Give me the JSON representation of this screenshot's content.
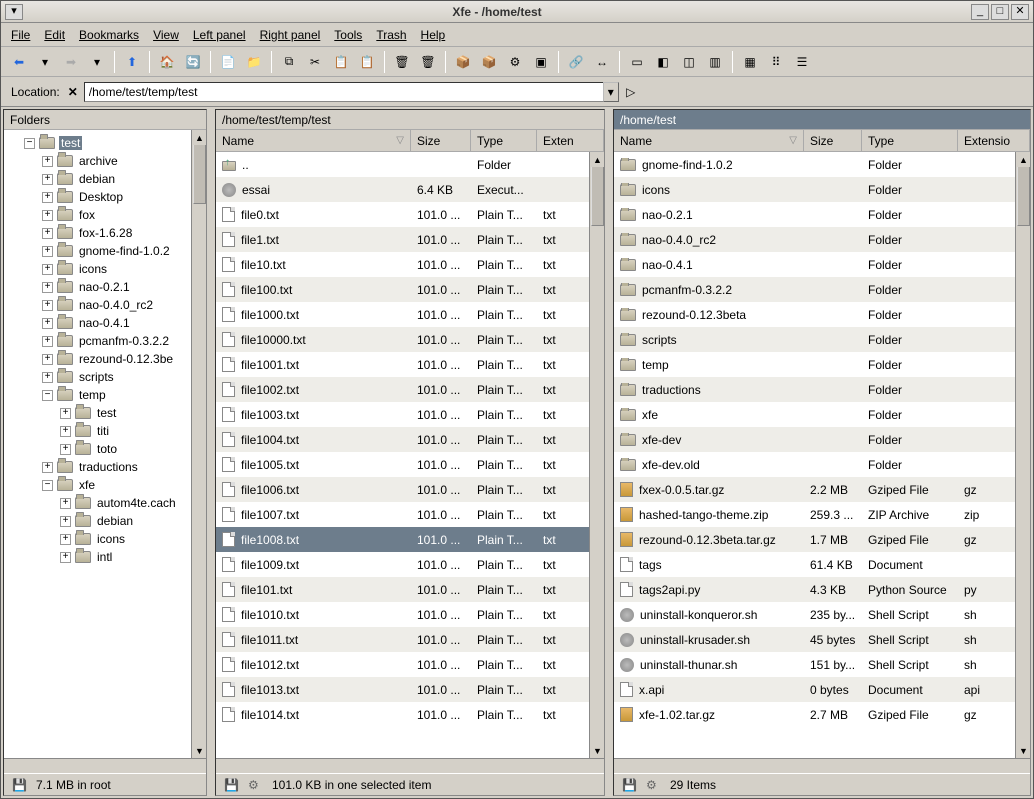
{
  "title": "Xfe - /home/test",
  "menus": [
    "File",
    "Edit",
    "Bookmarks",
    "View",
    "Left panel",
    "Right panel",
    "Tools",
    "Trash",
    "Help"
  ],
  "location": {
    "label": "Location:",
    "value": "/home/test/temp/test"
  },
  "tree": {
    "header": "Folders",
    "root": {
      "label": "test",
      "sel": true
    },
    "items": [
      {
        "label": "archive",
        "d": 1,
        "exp": "+"
      },
      {
        "label": "debian",
        "d": 1,
        "exp": "+"
      },
      {
        "label": "Desktop",
        "d": 1,
        "exp": "+"
      },
      {
        "label": "fox",
        "d": 1,
        "exp": "+"
      },
      {
        "label": "fox-1.6.28",
        "d": 1,
        "exp": "+"
      },
      {
        "label": "gnome-find-1.0.2",
        "d": 1,
        "exp": "+"
      },
      {
        "label": "icons",
        "d": 1,
        "exp": "+"
      },
      {
        "label": "nao-0.2.1",
        "d": 1,
        "exp": "+"
      },
      {
        "label": "nao-0.4.0_rc2",
        "d": 1,
        "exp": "+"
      },
      {
        "label": "nao-0.4.1",
        "d": 1,
        "exp": "+"
      },
      {
        "label": "pcmanfm-0.3.2.2",
        "d": 1,
        "exp": "+"
      },
      {
        "label": "rezound-0.12.3be",
        "d": 1,
        "exp": "+"
      },
      {
        "label": "scripts",
        "d": 1,
        "exp": "+"
      },
      {
        "label": "temp",
        "d": 1,
        "exp": "-"
      },
      {
        "label": "test",
        "d": 2,
        "exp": "+"
      },
      {
        "label": "titi",
        "d": 2,
        "exp": "+"
      },
      {
        "label": "toto",
        "d": 2,
        "exp": "+"
      },
      {
        "label": "traductions",
        "d": 1,
        "exp": "+"
      },
      {
        "label": "xfe",
        "d": 1,
        "exp": "-"
      },
      {
        "label": "autom4te.cach",
        "d": 2,
        "exp": "+"
      },
      {
        "label": "debian",
        "d": 2,
        "exp": "+"
      },
      {
        "label": "icons",
        "d": 2,
        "exp": "+"
      },
      {
        "label": "intl",
        "d": 2,
        "exp": "+"
      }
    ],
    "status": "7.1 MB in root"
  },
  "mid": {
    "path": "/home/test/temp/test",
    "cols": {
      "name": "Name",
      "size": "Size",
      "type": "Type",
      "ext": "Exten"
    },
    "rows": [
      {
        "icon": "up",
        "name": "..",
        "size": "",
        "type": "Folder",
        "ext": ""
      },
      {
        "icon": "gear",
        "name": "essai",
        "size": "6.4 KB",
        "type": "Execut...",
        "ext": ""
      },
      {
        "icon": "doc",
        "name": "file0.txt",
        "size": "101.0 ...",
        "type": "Plain T...",
        "ext": "txt"
      },
      {
        "icon": "doc",
        "name": "file1.txt",
        "size": "101.0 ...",
        "type": "Plain T...",
        "ext": "txt"
      },
      {
        "icon": "doc",
        "name": "file10.txt",
        "size": "101.0 ...",
        "type": "Plain T...",
        "ext": "txt"
      },
      {
        "icon": "doc",
        "name": "file100.txt",
        "size": "101.0 ...",
        "type": "Plain T...",
        "ext": "txt"
      },
      {
        "icon": "doc",
        "name": "file1000.txt",
        "size": "101.0 ...",
        "type": "Plain T...",
        "ext": "txt"
      },
      {
        "icon": "doc",
        "name": "file10000.txt",
        "size": "101.0 ...",
        "type": "Plain T...",
        "ext": "txt"
      },
      {
        "icon": "doc",
        "name": "file1001.txt",
        "size": "101.0 ...",
        "type": "Plain T...",
        "ext": "txt"
      },
      {
        "icon": "doc",
        "name": "file1002.txt",
        "size": "101.0 ...",
        "type": "Plain T...",
        "ext": "txt"
      },
      {
        "icon": "doc",
        "name": "file1003.txt",
        "size": "101.0 ...",
        "type": "Plain T...",
        "ext": "txt"
      },
      {
        "icon": "doc",
        "name": "file1004.txt",
        "size": "101.0 ...",
        "type": "Plain T...",
        "ext": "txt"
      },
      {
        "icon": "doc",
        "name": "file1005.txt",
        "size": "101.0 ...",
        "type": "Plain T...",
        "ext": "txt"
      },
      {
        "icon": "doc",
        "name": "file1006.txt",
        "size": "101.0 ...",
        "type": "Plain T...",
        "ext": "txt"
      },
      {
        "icon": "doc",
        "name": "file1007.txt",
        "size": "101.0 ...",
        "type": "Plain T...",
        "ext": "txt"
      },
      {
        "icon": "doc",
        "name": "file1008.txt",
        "size": "101.0 ...",
        "type": "Plain T...",
        "ext": "txt",
        "sel": true
      },
      {
        "icon": "doc",
        "name": "file1009.txt",
        "size": "101.0 ...",
        "type": "Plain T...",
        "ext": "txt"
      },
      {
        "icon": "doc",
        "name": "file101.txt",
        "size": "101.0 ...",
        "type": "Plain T...",
        "ext": "txt"
      },
      {
        "icon": "doc",
        "name": "file1010.txt",
        "size": "101.0 ...",
        "type": "Plain T...",
        "ext": "txt"
      },
      {
        "icon": "doc",
        "name": "file1011.txt",
        "size": "101.0 ...",
        "type": "Plain T...",
        "ext": "txt"
      },
      {
        "icon": "doc",
        "name": "file1012.txt",
        "size": "101.0 ...",
        "type": "Plain T...",
        "ext": "txt"
      },
      {
        "icon": "doc",
        "name": "file1013.txt",
        "size": "101.0 ...",
        "type": "Plain T...",
        "ext": "txt"
      },
      {
        "icon": "doc",
        "name": "file1014.txt",
        "size": "101.0 ...",
        "type": "Plain T...",
        "ext": "txt"
      }
    ],
    "status": "101.0 KB in one selected item"
  },
  "right": {
    "path": "/home/test",
    "cols": {
      "name": "Name",
      "size": "Size",
      "type": "Type",
      "ext": "Extensio"
    },
    "rows": [
      {
        "icon": "folder",
        "name": "gnome-find-1.0.2",
        "size": "",
        "type": "Folder",
        "ext": ""
      },
      {
        "icon": "folder",
        "name": "icons",
        "size": "",
        "type": "Folder",
        "ext": ""
      },
      {
        "icon": "folder",
        "name": "nao-0.2.1",
        "size": "",
        "type": "Folder",
        "ext": ""
      },
      {
        "icon": "folder",
        "name": "nao-0.4.0_rc2",
        "size": "",
        "type": "Folder",
        "ext": ""
      },
      {
        "icon": "folder",
        "name": "nao-0.4.1",
        "size": "",
        "type": "Folder",
        "ext": ""
      },
      {
        "icon": "folder",
        "name": "pcmanfm-0.3.2.2",
        "size": "",
        "type": "Folder",
        "ext": ""
      },
      {
        "icon": "folder",
        "name": "rezound-0.12.3beta",
        "size": "",
        "type": "Folder",
        "ext": ""
      },
      {
        "icon": "folder",
        "name": "scripts",
        "size": "",
        "type": "Folder",
        "ext": ""
      },
      {
        "icon": "folder",
        "name": "temp",
        "size": "",
        "type": "Folder",
        "ext": ""
      },
      {
        "icon": "folder",
        "name": "traductions",
        "size": "",
        "type": "Folder",
        "ext": ""
      },
      {
        "icon": "folder",
        "name": "xfe",
        "size": "",
        "type": "Folder",
        "ext": ""
      },
      {
        "icon": "folder",
        "name": "xfe-dev",
        "size": "",
        "type": "Folder",
        "ext": ""
      },
      {
        "icon": "folder",
        "name": "xfe-dev.old",
        "size": "",
        "type": "Folder",
        "ext": ""
      },
      {
        "icon": "arc",
        "name": "fxex-0.0.5.tar.gz",
        "size": "2.2 MB",
        "type": "Gziped File",
        "ext": "gz"
      },
      {
        "icon": "arc",
        "name": "hashed-tango-theme.zip",
        "size": "259.3 ...",
        "type": "ZIP Archive",
        "ext": "zip"
      },
      {
        "icon": "arc",
        "name": "rezound-0.12.3beta.tar.gz",
        "size": "1.7 MB",
        "type": "Gziped File",
        "ext": "gz"
      },
      {
        "icon": "doc",
        "name": "tags",
        "size": "61.4 KB",
        "type": "Document",
        "ext": ""
      },
      {
        "icon": "doc",
        "name": "tags2api.py",
        "size": "4.3 KB",
        "type": "Python Source",
        "ext": "py"
      },
      {
        "icon": "gear",
        "name": "uninstall-konqueror.sh",
        "size": "235 by...",
        "type": "Shell Script",
        "ext": "sh"
      },
      {
        "icon": "gear",
        "name": "uninstall-krusader.sh",
        "size": "45 bytes",
        "type": "Shell Script",
        "ext": "sh"
      },
      {
        "icon": "gear",
        "name": "uninstall-thunar.sh",
        "size": "151 by...",
        "type": "Shell Script",
        "ext": "sh"
      },
      {
        "icon": "doc",
        "name": "x.api",
        "size": "0 bytes",
        "type": "Document",
        "ext": "api"
      },
      {
        "icon": "arc",
        "name": "xfe-1.02.tar.gz",
        "size": "2.7 MB",
        "type": "Gziped File",
        "ext": "gz"
      }
    ],
    "status": "29 Items"
  }
}
